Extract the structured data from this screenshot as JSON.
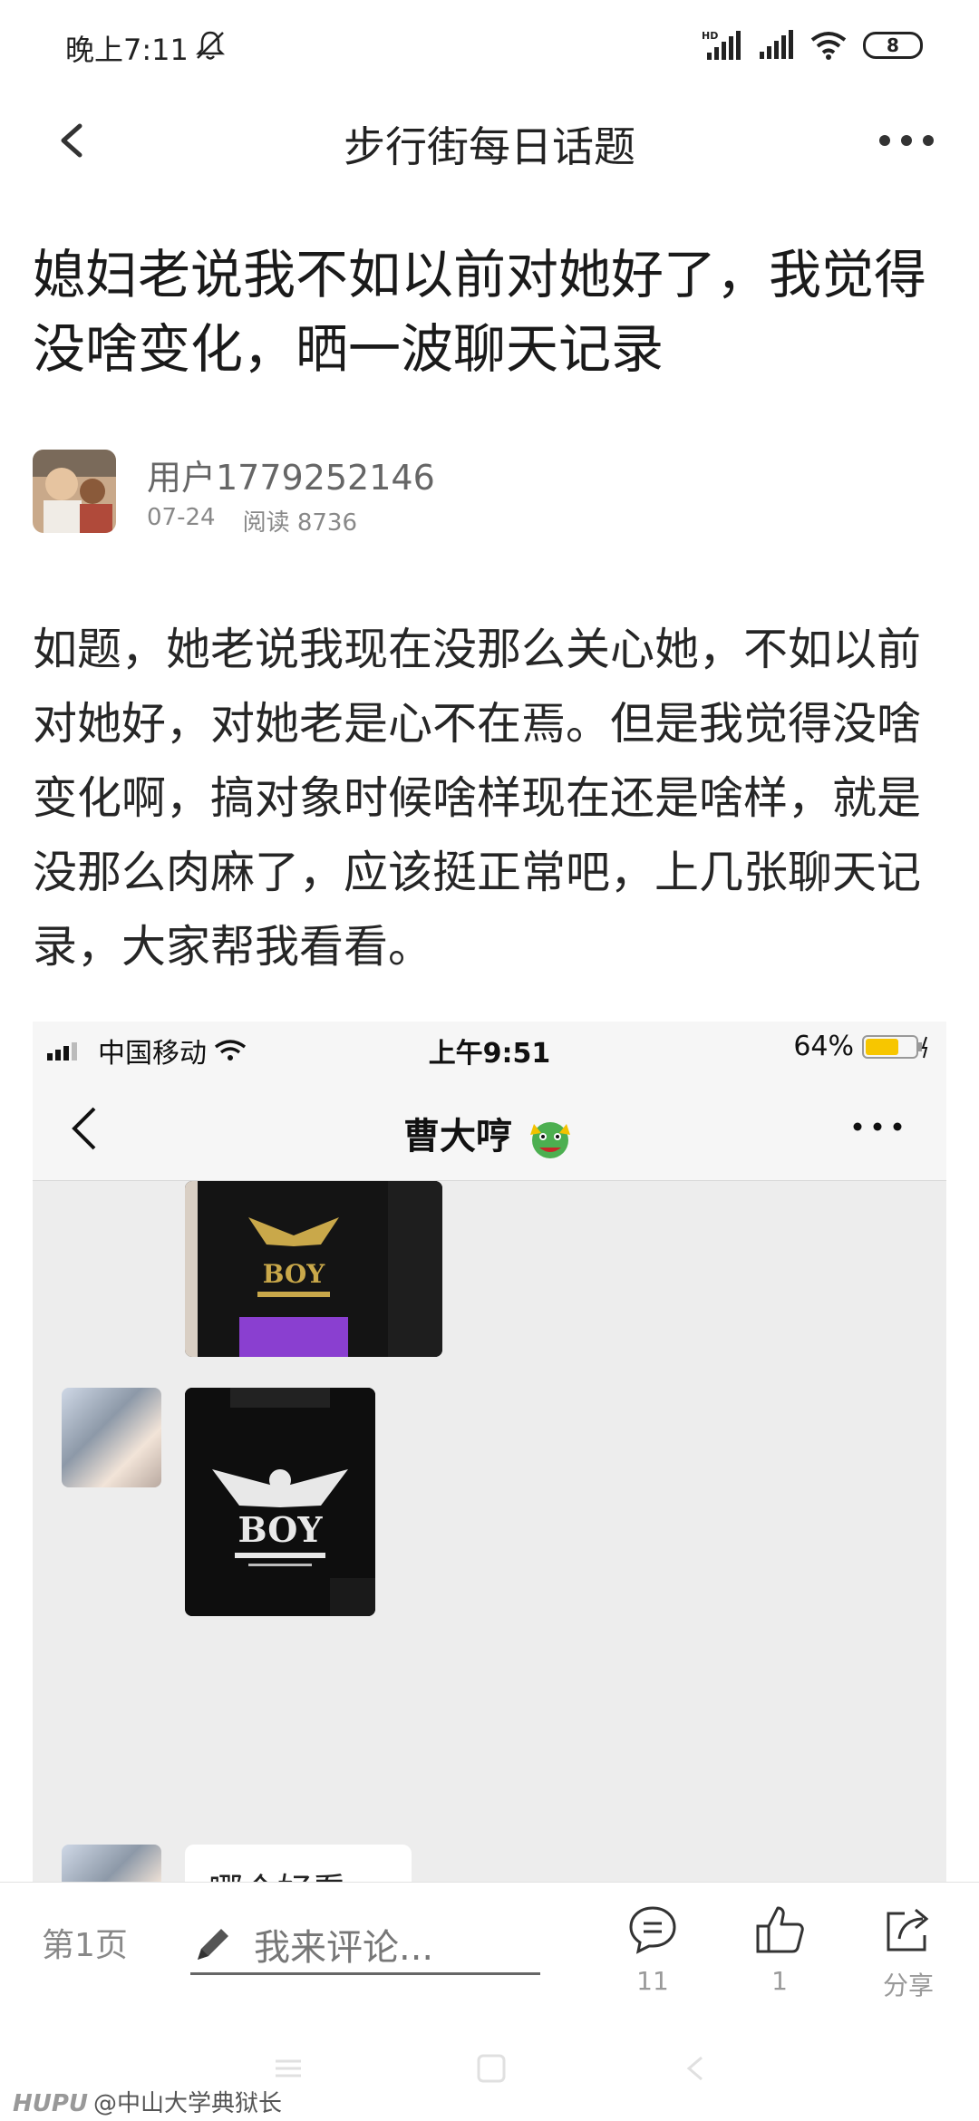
{
  "status_bar": {
    "time": "晚上7:11",
    "battery": "8"
  },
  "nav": {
    "title": "步行街每日话题"
  },
  "post": {
    "title": "媳妇老说我不如以前对她好了，我觉得没啥变化，晒一波聊天记录",
    "author": "用户1779252146",
    "date": "07-24",
    "views": "阅读 8736",
    "body": "如题，她老说我现在没那么关心她，不如以前对她好，对她老是心不在焉。但是我觉得没啥变化啊，搞对象时候啥样现在还是啥样，就是没那么肉麻了，应该挺正常吧，上几张聊天记录，大家帮我看看。"
  },
  "embedded_screenshot": {
    "carrier": "中国移动",
    "time": "上午9:51",
    "battery": "64%",
    "chat_title": "曹大哼",
    "bubble_text": "哪个好看",
    "shirt_text": "BOY"
  },
  "action_bar": {
    "page": "第1页",
    "comment_placeholder": "我来评论...",
    "comments_count": "11",
    "likes_count": "1",
    "share_label": "分享"
  },
  "watermark": {
    "brand": "HUPU",
    "handle": "@中山大学典狱长"
  },
  "colors": {
    "text_primary": "#1a1a1a",
    "text_muted": "#888888",
    "chat_bg": "#ededed"
  }
}
